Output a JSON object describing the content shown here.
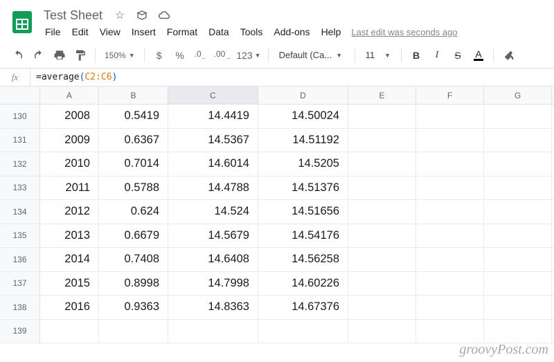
{
  "doc": {
    "title": "Test Sheet"
  },
  "menu": {
    "file": "File",
    "edit": "Edit",
    "view": "View",
    "insert": "Insert",
    "format": "Format",
    "data": "Data",
    "tools": "Tools",
    "addons": "Add-ons",
    "help": "Help",
    "lastedit": "Last edit was seconds ago"
  },
  "toolbar": {
    "zoom": "150%",
    "currency": "$",
    "percent": "%",
    "dec_less": ".0",
    "dec_more": ".00",
    "more_formats": "123",
    "font": "Default (Ca...",
    "fontsize": "11",
    "bold": "B",
    "italic": "I",
    "strike": "S",
    "textcolor": "A"
  },
  "fx": {
    "prefix": "=average",
    "open": "(",
    "ref": "C2:C6",
    "close": ")"
  },
  "grid": {
    "cols": [
      "A",
      "B",
      "C",
      "D",
      "E",
      "F",
      "G"
    ],
    "selected_col_index": 2,
    "rows": [
      {
        "n": 130,
        "cells": [
          "2008",
          "0.5419",
          "14.4419",
          "14.50024",
          "",
          "",
          ""
        ]
      },
      {
        "n": 131,
        "cells": [
          "2009",
          "0.6367",
          "14.5367",
          "14.51192",
          "",
          "",
          ""
        ]
      },
      {
        "n": 132,
        "cells": [
          "2010",
          "0.7014",
          "14.6014",
          "14.5205",
          "",
          "",
          ""
        ]
      },
      {
        "n": 133,
        "cells": [
          "2011",
          "0.5788",
          "14.4788",
          "14.51376",
          "",
          "",
          ""
        ]
      },
      {
        "n": 134,
        "cells": [
          "2012",
          "0.624",
          "14.524",
          "14.51656",
          "",
          "",
          ""
        ]
      },
      {
        "n": 135,
        "cells": [
          "2013",
          "0.6679",
          "14.5679",
          "14.54176",
          "",
          "",
          ""
        ]
      },
      {
        "n": 136,
        "cells": [
          "2014",
          "0.7408",
          "14.6408",
          "14.56258",
          "",
          "",
          ""
        ]
      },
      {
        "n": 137,
        "cells": [
          "2015",
          "0.8998",
          "14.7998",
          "14.60226",
          "",
          "",
          ""
        ]
      },
      {
        "n": 138,
        "cells": [
          "2016",
          "0.9363",
          "14.8363",
          "14.67376",
          "",
          "",
          ""
        ]
      },
      {
        "n": 139,
        "cells": [
          "",
          "",
          "",
          "",
          "",
          "",
          ""
        ]
      }
    ]
  },
  "watermark": "groovyPost.com"
}
